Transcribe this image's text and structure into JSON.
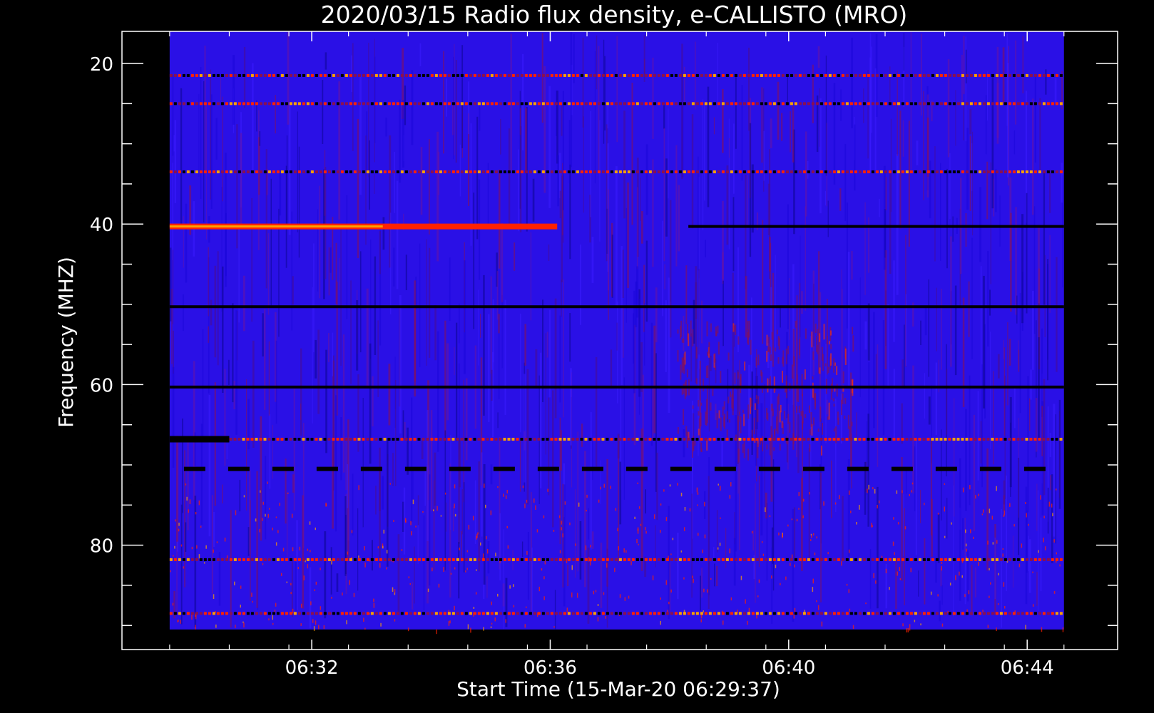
{
  "chart_data": {
    "type": "heatmap",
    "title": "2020/03/15  Radio flux density, e-CALLISTO (MRO)",
    "xlabel": "Start Time (15-Mar-20 06:29:37)",
    "ylabel": "Frequency (MHZ)",
    "x_ticks": [
      "06:32",
      "06:36",
      "06:40",
      "06:44"
    ],
    "x_tick_values_min": [
      2.383,
      6.383,
      10.383,
      14.383
    ],
    "x_minor_step_min": 1,
    "xlim_min": [
      -0.8,
      15.9
    ],
    "y_ticks": [
      20,
      40,
      60,
      80
    ],
    "y_minor_step": 5,
    "ylim": [
      16,
      93
    ],
    "ylim_note_inverted": true,
    "data_extent": {
      "x_min": [
        0.0,
        15.0
      ],
      "y_mhz": [
        16,
        90.5
      ]
    },
    "colormap": [
      "#000000",
      "#1a06d8",
      "#2a12ff",
      "#8a1050",
      "#ff2200",
      "#ffa000",
      "#ffff40"
    ],
    "bands": [
      {
        "freq": 21.5,
        "state": "mixed"
      },
      {
        "freq": 25.0,
        "state": "mixed"
      },
      {
        "freq": 33.5,
        "state": "mixed"
      },
      {
        "freq": 40.3,
        "state": "hot",
        "x_range_min": [
          0.0,
          6.5
        ]
      },
      {
        "freq": 40.3,
        "state": "cold",
        "x_range_min": [
          8.7,
          15.0
        ]
      },
      {
        "freq": 50.3,
        "state": "cold"
      },
      {
        "freq": 60.3,
        "state": "cold"
      },
      {
        "freq": 66.8,
        "state": "cold_thick",
        "x_range_min": [
          0.0,
          1.0
        ]
      },
      {
        "freq": 66.8,
        "state": "mixed",
        "x_range_min": [
          1.0,
          15.0
        ]
      },
      {
        "freq": 70.5,
        "state": "dashed_cold"
      },
      {
        "freq": 81.8,
        "state": "mixed"
      },
      {
        "freq": 88.5,
        "state": "mixed"
      }
    ]
  },
  "colors": {
    "background": "#000000",
    "axes": "#ffffff",
    "base": "#2a10e6"
  }
}
